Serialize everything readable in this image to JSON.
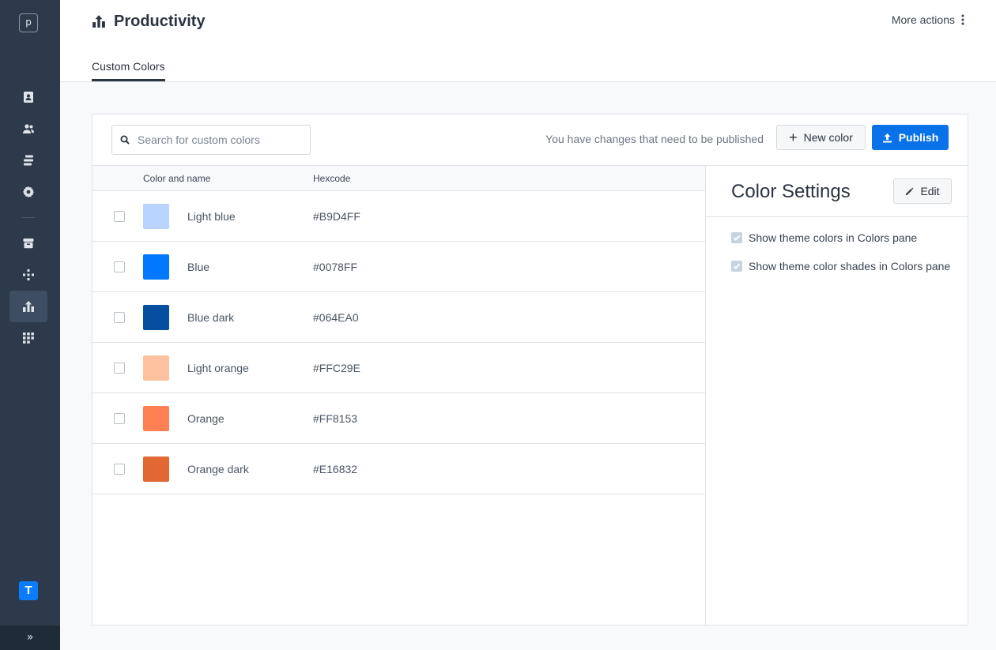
{
  "sidebar": {
    "logo_letter": "p",
    "brand_letter": "T",
    "collapse_glyph": "»",
    "items": [
      {
        "icon": "contact-card-icon"
      },
      {
        "icon": "users-icon"
      },
      {
        "icon": "layers-icon"
      },
      {
        "icon": "gear-icon"
      },
      {
        "icon": "archive-icon"
      },
      {
        "icon": "plus-nodes-icon"
      },
      {
        "icon": "productivity-icon",
        "active": true
      },
      {
        "icon": "grid-icon"
      }
    ]
  },
  "header": {
    "title": "Productivity",
    "more_actions": "More actions",
    "tabs": [
      {
        "label": "Custom Colors",
        "active": true
      }
    ]
  },
  "toolbar": {
    "search_placeholder": "Search for custom colors",
    "pending_message": "You have changes that need to be published",
    "new_color_label": "New color",
    "publish_label": "Publish"
  },
  "table": {
    "columns": {
      "name": "Color and name",
      "hex": "Hexcode"
    },
    "rows": [
      {
        "name": "Light blue",
        "hex": "#B9D4FF",
        "swatch": "#B9D4FF"
      },
      {
        "name": "Blue",
        "hex": "#0078FF",
        "swatch": "#0078FF"
      },
      {
        "name": "Blue dark",
        "hex": "#064EA0",
        "swatch": "#064EA0"
      },
      {
        "name": "Light orange",
        "hex": "#FFC29E",
        "swatch": "#FFC29E"
      },
      {
        "name": "Orange",
        "hex": "#FF8153",
        "swatch": "#FF8153"
      },
      {
        "name": "Orange dark",
        "hex": "#E16832",
        "swatch": "#E16832"
      }
    ]
  },
  "settings": {
    "title": "Color Settings",
    "edit_label": "Edit",
    "options": [
      {
        "label": "Show theme colors in Colors pane",
        "checked": true
      },
      {
        "label": "Show theme color shades in Colors pane",
        "checked": true
      }
    ]
  },
  "colors": {
    "sidebar_bg": "#2c3a4b",
    "accent": "#0a72e8"
  }
}
